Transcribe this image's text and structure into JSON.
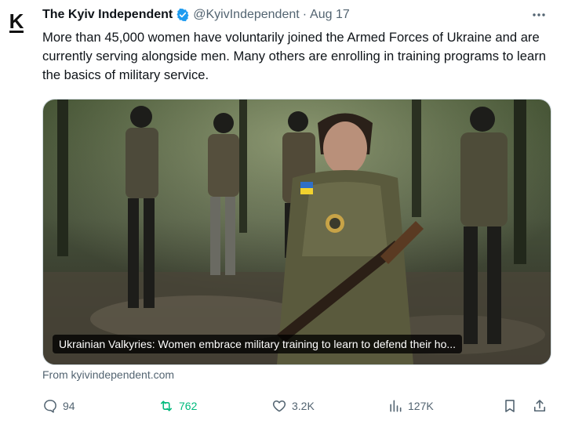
{
  "tweet": {
    "avatar_letter": "K",
    "author_name": "The Kyiv Independent",
    "handle": "@KyivIndependent",
    "separator": "·",
    "date": "Aug 17",
    "text": "More than 45,000 women have voluntarily joined the Armed Forces of Ukraine and are currently serving alongside men. Many others are enrolling in training programs to learn the basics of military service.",
    "media_caption": "Ukrainian Valkyries: Women embrace military training to learn to defend their ho...",
    "source": "From kyivindependent.com"
  },
  "actions": {
    "replies": "94",
    "reposts": "762",
    "likes": "3.2K",
    "views": "127K"
  },
  "icons": {
    "verified": "verified-badge-icon",
    "more": "more-options-icon",
    "reply": "reply-icon",
    "repost": "repost-icon",
    "like": "heart-icon",
    "views": "views-icon",
    "bookmark": "bookmark-icon",
    "share": "share-icon"
  },
  "colors": {
    "text": "#0f1419",
    "secondary": "#536471",
    "verified": "#1d9bf0",
    "repost_active": "#00ba7c"
  }
}
